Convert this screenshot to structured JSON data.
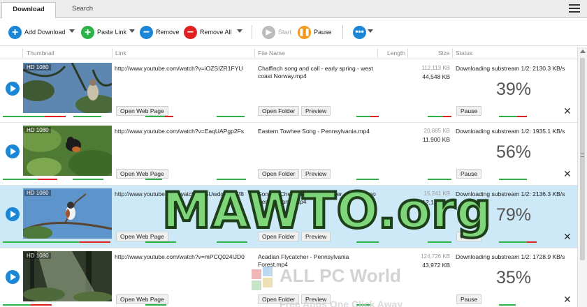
{
  "tabs": [
    {
      "label": "Download"
    },
    {
      "label": "Search"
    }
  ],
  "toolbar": {
    "add_download": "Add Download",
    "paste_link": "Paste Link",
    "remove": "Remove",
    "remove_all": "Remove All",
    "start": "Start",
    "pause": "Pause"
  },
  "columns": {
    "thumbnail": "Thumbnail",
    "link": "Link",
    "file_name": "File Name",
    "length": "Length",
    "size": "Size",
    "status": "Status"
  },
  "rows": [
    {
      "hd": "HD 1080",
      "link": "http://www.youtube.com/watch?v=iOZSIZR1FYU",
      "file_name": "Chaffinch song and call - early spring - west coast Norway.mp4",
      "size_total": "112,113 KB",
      "size_done": "44,548 KB",
      "status": "Downloading substream 1/2: 2130.3 KB/s",
      "percent": "39%",
      "open_web": "Open Web Page",
      "open_folder": "Open Folder",
      "preview": "Preview",
      "pause": "Pause"
    },
    {
      "hd": "HD 1080",
      "link": "http://www.youtube.com/watch?v=EaqUAPgp2Fs",
      "file_name": "Eastern Towhee Song - Pennsylvania.mp4",
      "size_total": "20,885 KB",
      "size_done": "11,900 KB",
      "status": "Downloading substream 1/2: 1935.1 KB/s",
      "percent": "56%",
      "open_web": "Open Web Page",
      "open_folder": "Open Folder",
      "preview": "Preview",
      "pause": "Pause"
    },
    {
      "hd": "HD 1080",
      "link": "http://www.youtube.com/watch?v=SUwdcC7SSf8",
      "file_name": "Song of Chestnut-sided Warbler - Mt Pocono Pennsylvania.mp4",
      "size_total": "15,241 KB",
      "size_done": "12,180 KB",
      "status": "Downloading substream 1/2: 2136.3 KB/s",
      "percent": "79%",
      "open_web": "Open Web Page",
      "open_folder": "Open Folder",
      "preview": "Preview",
      "pause": "Pause"
    },
    {
      "hd": "HD 1080",
      "link": "http://www.youtube.com/watch?v=mPCQ024IJD0",
      "file_name": "Acadian Flycatcher - Pennsylvania Forest.mp4",
      "size_total": "124,726 KB",
      "size_done": "43,972 KB",
      "status": "Downloading substream 1/2: 1728.9 KB/s",
      "percent": "35%",
      "open_web": "Open Web Page",
      "open_folder": "Open Folder",
      "preview": "Preview",
      "pause": "Pause"
    }
  ],
  "watermark": {
    "main": "MAWTO.org",
    "brand": "ALL PC World",
    "tagline": "Free Apps One Click Away"
  },
  "colors": {
    "accent_blue": "#1b86d6",
    "green": "#2db24a",
    "red": "#e02020",
    "orange": "#f39a1e",
    "selected_row": "#cde8f7"
  }
}
